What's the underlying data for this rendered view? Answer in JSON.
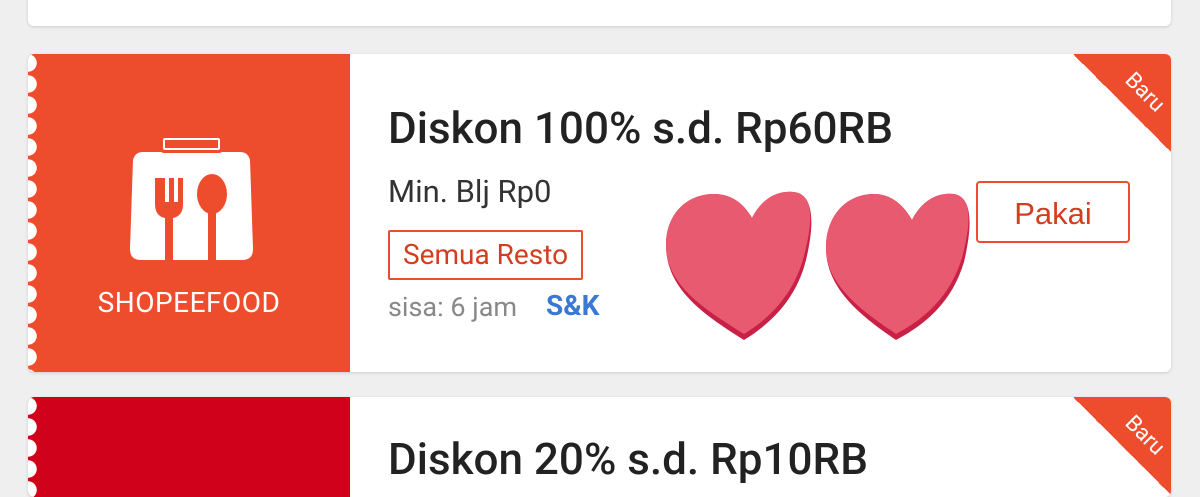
{
  "voucher": {
    "brand_label": "SHOPEEFOOD",
    "title": "Diskon 100% s.d. Rp60RB",
    "min_spend": "Min. Blj Rp0",
    "tag": "Semua Resto",
    "expiry": "sisa: 6 jam",
    "terms_link": "S&K",
    "use_button": "Pakai",
    "ribbon": "Baru"
  },
  "next_voucher": {
    "title": "Diskon 20% s.d. Rp10RB",
    "ribbon": "Baru"
  },
  "colors": {
    "accent": "#ee4d2d",
    "next_brand": "#d0011b",
    "link": "#3a78d8",
    "heart": "#e75a70"
  },
  "icons": {
    "brand": "shopeefood-bag-fork-spoon-icon",
    "decoration": "hearts-icon"
  }
}
